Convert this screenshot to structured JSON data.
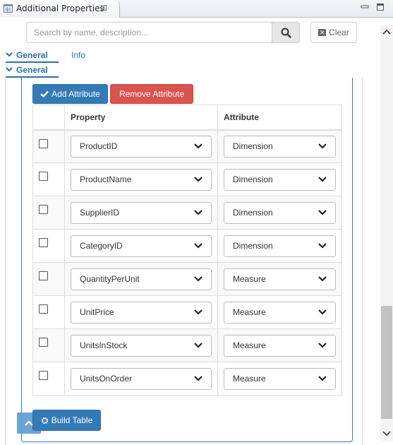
{
  "view": {
    "title": "Additional Properties",
    "close_glyph": "☒"
  },
  "search": {
    "placeholder": "Search by name, description...",
    "value": "",
    "clear_label": "Clear"
  },
  "sections": {
    "general_tab_label": "General",
    "info_tab_label": "Info",
    "general_section_label": "General"
  },
  "toolbar": {
    "add_label": "Add Attribute",
    "remove_label": "Remove Attribute",
    "build_label": "Build Table"
  },
  "table": {
    "columns": [
      "Property",
      "Attribute"
    ],
    "rows": [
      {
        "property": "ProductID",
        "attribute": "Dimension",
        "checked": false
      },
      {
        "property": "ProductName",
        "attribute": "Dimension",
        "checked": false
      },
      {
        "property": "SupplierID",
        "attribute": "Dimension",
        "checked": false
      },
      {
        "property": "CategoryID",
        "attribute": "Dimension",
        "checked": false
      },
      {
        "property": "QuantityPerUnit",
        "attribute": "Measure",
        "checked": false
      },
      {
        "property": "UnitPrice",
        "attribute": "Measure",
        "checked": false
      },
      {
        "property": "UnitsInStock",
        "attribute": "Measure",
        "checked": false
      },
      {
        "property": "UnitsOnOrder",
        "attribute": "Measure",
        "checked": false
      }
    ]
  },
  "colors": {
    "primary": "#337ab7",
    "danger": "#d9534f",
    "link": "#2a6fb0"
  },
  "icons": {
    "search": "search-icon",
    "add": "check-icon",
    "build": "gear-icon",
    "back_to_top": "chevron-up-icon"
  }
}
